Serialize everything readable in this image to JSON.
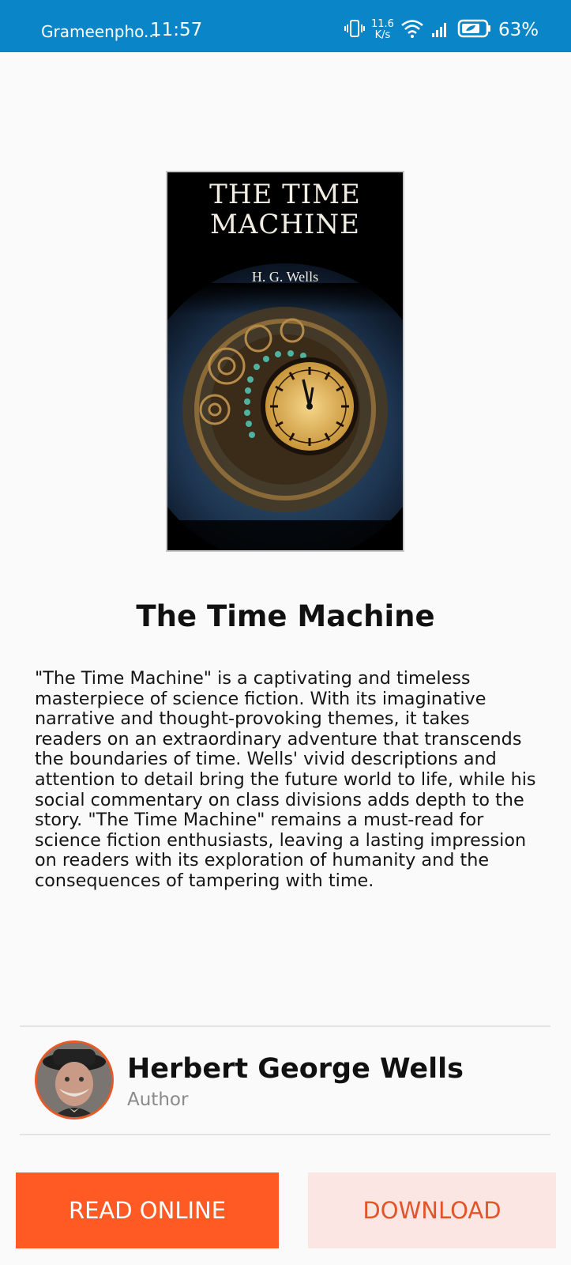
{
  "status_bar": {
    "carrier": "Grameenpho...",
    "time": "11:57",
    "net_speed_value": "11.6",
    "net_speed_unit": "K/s",
    "battery": "63%"
  },
  "cover": {
    "title_line1": "THE TIME",
    "title_line2": "MACHINE",
    "author": "H. G. Wells"
  },
  "book": {
    "title": "The Time Machine",
    "description": "\"The Time Machine\" is a captivating and timeless masterpiece of science fiction. With its imaginative narrative and thought-provoking themes, it takes readers on an extraordinary adventure that transcends the boundaries of time. Wells' vivid descriptions and attention to detail bring the future world to life, while his social commentary on class divisions adds depth to the story. \"The Time Machine\" remains a must-read for science fiction enthusiasts, leaving a lasting impression on readers with its exploration of humanity and the consequences of tampering with time."
  },
  "author": {
    "name": "Herbert George Wells",
    "role": "Author"
  },
  "actions": {
    "read_online": "READ ONLINE",
    "download": "DOWNLOAD"
  },
  "colors": {
    "status_bar": "#0a86c8",
    "accent": "#ff5a24",
    "download_bg": "#fbe6e3",
    "download_text": "#e1552a"
  }
}
